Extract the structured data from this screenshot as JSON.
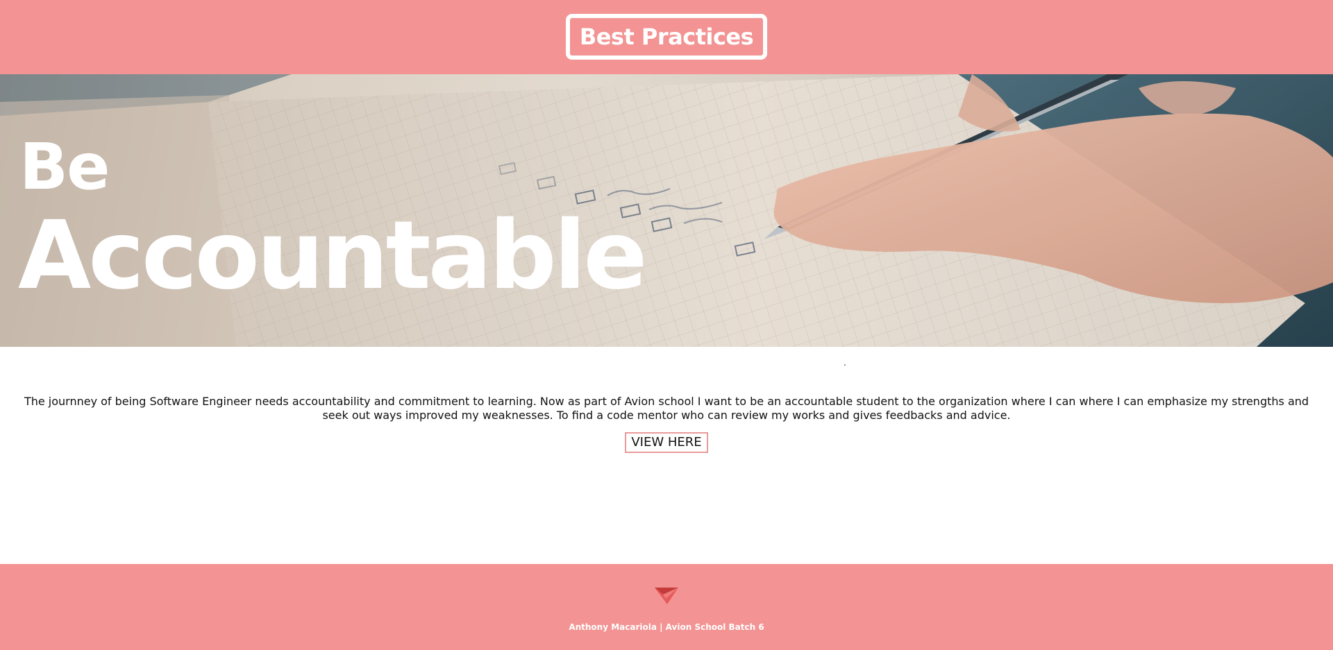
{
  "header": {
    "brand_title": "Best Practices",
    "background_color": "#f39393"
  },
  "hero": {
    "line1": "Be",
    "line2": "Accountable",
    "image_description_icon": "notebook-checklist-pen-image"
  },
  "content": {
    "separator_dot": ".",
    "intro_text": "The journney of being Software Engineer needs accountability and commitment to learning. Now as part of Avion school I want to be an accountable student to the organization where I can where I can emphasize my strengths and seek out ways improved my weaknesses. To find a code mentor who can review my works and gives feedbacks and advice.",
    "view_button_label": "VIEW HERE",
    "button_border_color": "#ea9a9a"
  },
  "footer": {
    "icon": "paper-plane-icon",
    "credit": "Anthony Macariola | Avion School Batch 6",
    "background_color": "#f39393"
  }
}
